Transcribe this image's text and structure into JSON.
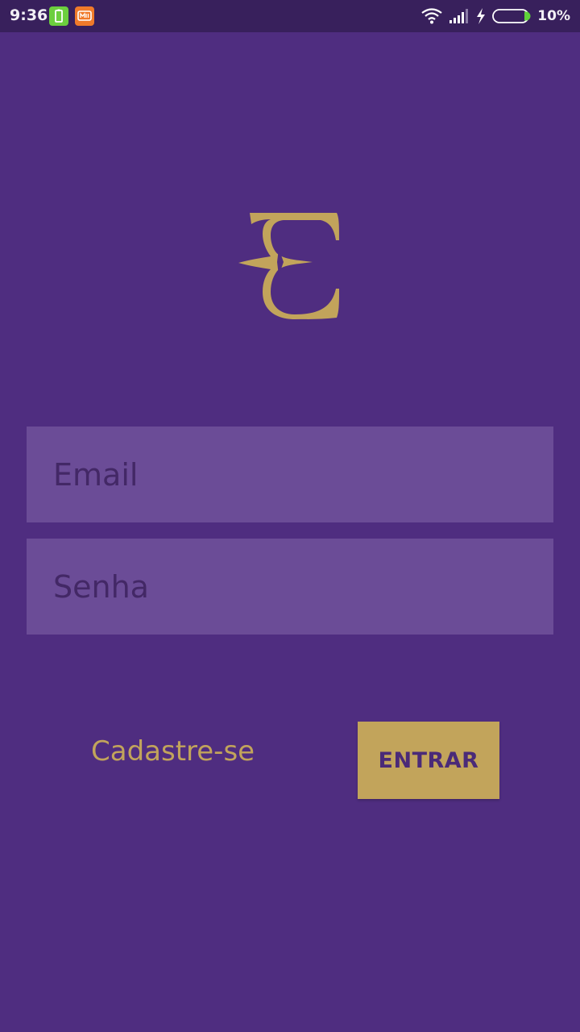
{
  "status_bar": {
    "time": "9:36",
    "battery_percent": "10%",
    "notification_icons": [
      "battery-app-icon",
      "mi-app-icon"
    ],
    "indicator_icons": [
      "wifi-icon",
      "cellular-signal-icon",
      "charging-bolt-icon",
      "battery-icon"
    ],
    "background": "#38205c"
  },
  "logo": {
    "letter": "E",
    "color": "#c2a45b"
  },
  "login_form": {
    "email_placeholder": "Email",
    "password_placeholder": "Senha",
    "field_background": "#6b4c97"
  },
  "actions": {
    "signup_label": "Cadastre-se",
    "login_label": "ENTRAR",
    "accent": "#c2a45b"
  },
  "theme": {
    "background": "#4f2d80"
  }
}
